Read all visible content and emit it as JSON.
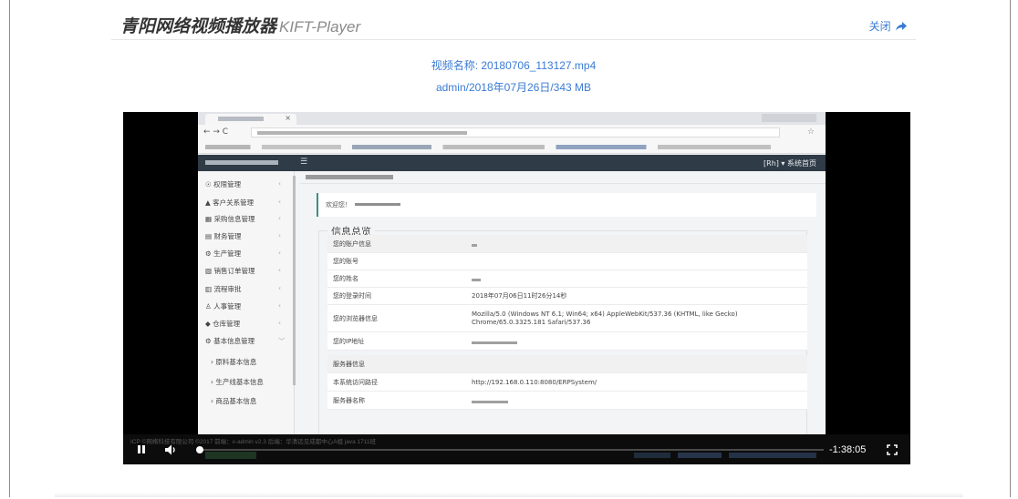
{
  "header": {
    "title": "青阳网络视频播放器",
    "title_sub": "KIFT-Player",
    "close_label": "关闭",
    "close_icon": "share-arrow-icon"
  },
  "video_info": {
    "name_line": "视频名称: 20180706_113127.mp4",
    "detail_line": "admin/2018年07月26日/343 MB"
  },
  "screen": {
    "appbar_right": "[Rh] ▾   系统首页",
    "sidebar": [
      {
        "label": "☉ 权限管理",
        "chevron": "‹"
      },
      {
        "label": "▲ 客户关系管理",
        "chevron": "‹"
      },
      {
        "label": "▦ 采购信息管理",
        "chevron": "‹"
      },
      {
        "label": "▤ 财务管理",
        "chevron": "‹"
      },
      {
        "label": "⚙ 生产管理",
        "chevron": "‹"
      },
      {
        "label": "▧ 销售订单管理",
        "chevron": "‹"
      },
      {
        "label": "▥ 流程审批",
        "chevron": "‹"
      },
      {
        "label": "♙ 人事管理",
        "chevron": "‹"
      },
      {
        "label": "◆ 仓库管理",
        "chevron": "‹"
      },
      {
        "label": "⚙ 基本信息管理",
        "chevron": "﹀"
      },
      {
        "label": "› 原料基本信息",
        "chevron": ""
      },
      {
        "label": "› 生产线基本信息",
        "chevron": ""
      },
      {
        "label": "› 商品基本信息",
        "chevron": ""
      }
    ],
    "welcome_text": "欢迎您！",
    "section_title": "信息总览",
    "rows": [
      {
        "label": "您的账户信息",
        "value": "",
        "head": true
      },
      {
        "label": "您的账号",
        "value": ""
      },
      {
        "label": "您的姓名",
        "value": ""
      },
      {
        "label": "您的登录时间",
        "value": "2018年07月06日11时26分14秒"
      },
      {
        "label": "您的浏览器信息",
        "value": "Mozilla/5.0 (Windows NT 6.1; Win64; x64) AppleWebKit/537.36 (KHTML, like Gecko) Chrome/65.0.3325.181 Safari/537.36"
      },
      {
        "label": "您的IP地址",
        "value": ""
      },
      {
        "label": "服务器信息",
        "value": "",
        "head": true
      },
      {
        "label": "本系统访问路径",
        "value": "http://192.168.0.110:8080/ERPSystem/"
      },
      {
        "label": "服务器名称",
        "value": ""
      }
    ],
    "status_text": "ICP ©网络科技有限公司 ©2017 前端：x-admin v2.3 后端：华清远见成都中心A组 java 1711班"
  },
  "controls": {
    "pause_icon": "pause-icon",
    "volume_icon": "volume-icon",
    "fullscreen_icon": "fullscreen-icon",
    "progress": 0.0,
    "time_remaining": "-1:38:05"
  }
}
